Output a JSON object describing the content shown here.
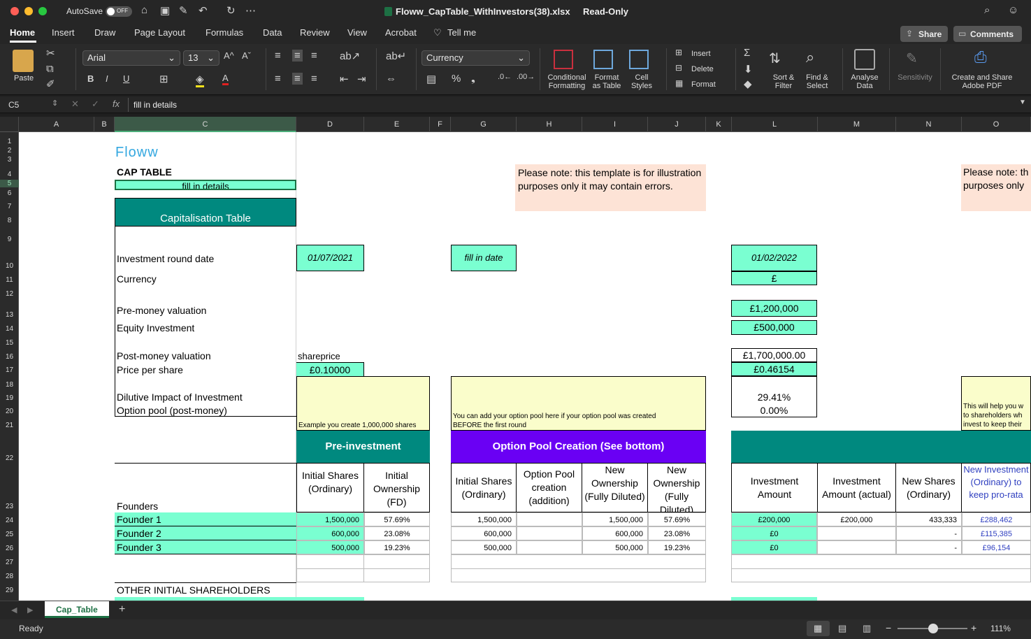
{
  "window": {
    "title": "Floww_CapTable_WithInvestors(38).xlsx",
    "mode": "Read-Only",
    "autosave": "AutoSave",
    "autosave_state": "OFF"
  },
  "ribbon_tabs": [
    "Home",
    "Insert",
    "Draw",
    "Page Layout",
    "Formulas",
    "Data",
    "Review",
    "View",
    "Acrobat",
    "Tell me"
  ],
  "share": "Share",
  "comments": "Comments",
  "ribbon": {
    "paste": "Paste",
    "font": "Arial",
    "size": "13",
    "number_format": "Currency",
    "cond_fmt_1": "Conditional",
    "cond_fmt_2": "Formatting",
    "fmt_table_1": "Format",
    "fmt_table_2": "as Table",
    "cell_styles_1": "Cell",
    "cell_styles_2": "Styles",
    "insert": "Insert",
    "delete": "Delete",
    "format": "Format",
    "sort_1": "Sort &",
    "sort_2": "Filter",
    "find_1": "Find &",
    "find_2": "Select",
    "analyse_1": "Analyse",
    "analyse_2": "Data",
    "sensitivity": "Sensitivity",
    "adobe_1": "Create and Share",
    "adobe_2": "Adobe PDF"
  },
  "formula_bar": {
    "cell_ref": "C5",
    "fx": "fx",
    "content": "fill in details"
  },
  "columns": [
    "A",
    "B",
    "C",
    "D",
    "E",
    "F",
    "G",
    "H",
    "I",
    "J",
    "K",
    "L",
    "M",
    "N",
    "O"
  ],
  "rows": [
    "1",
    "2",
    "3",
    "4",
    "5",
    "6",
    "7",
    "8",
    "9",
    "10",
    "11",
    "12",
    "13",
    "14",
    "15",
    "16",
    "17",
    "18",
    "19",
    "20",
    "21",
    "22",
    "23",
    "24",
    "25",
    "26",
    "27",
    "28",
    "29"
  ],
  "sheet": {
    "logo": "Floww",
    "cap_table": "CAP TABLE",
    "fill_details": "fill in details",
    "note": "Please note: this template is for illustration purposes only it may contain errors.",
    "note_right_1": "Please note: th",
    "note_right_2": "purposes only",
    "cap_title": "Capitalisation Table",
    "labels": {
      "round_date": "Investment round date",
      "currency": "Currency",
      "pre_money": "Pre-money valuation",
      "equity": "Equity Investment",
      "post_money": "Post-money valuation",
      "pps": "Price per share",
      "dilutive": "Dilutive Impact of Investment",
      "option_pool": "Option pool (post-money)",
      "founders": "Founders",
      "other": "OTHER INITIAL SHAREHOLDERS"
    },
    "d_date": "01/07/2021",
    "g_date": "fill in date",
    "l_date": "01/02/2022",
    "l_currency": "£",
    "l_pre": "£1,200,000",
    "l_equity": "£500,000",
    "l_post": "£1,700,000.00",
    "d_shareprice_label": "shareprice",
    "d_pps": "£0.10000",
    "l_pps": "£0.46154",
    "l_dilutive": "29.41%",
    "l_pool": "0.00%",
    "d_example": "Example you create 1,000,000 shares",
    "g_note_1": "You can add your option pool here if your option pool was created",
    "g_note_2": "BEFORE the first round",
    "o_note_1": "This will help you w",
    "o_note_2": "to shareholders wh",
    "o_note_3": "invest to keep their",
    "pre_investment": "Pre-investment",
    "option_pool_creation": "Option Pool Creation (See bottom)",
    "headers": {
      "d": "Initial Shares (Ordinary)",
      "e": "Initial Ownership (FD)",
      "g": "Initial Shares (Ordinary)",
      "h": "Option Pool creation (addition)",
      "i": "New Ownership (Fully Diluted)",
      "j": "New Ownership (Fully Diluted)",
      "l": "Investment Amount",
      "m": "Investment Amount (actual)",
      "n": "New Shares (Ordinary)",
      "o": "New Investment (Ordinary) to keep pro-rata"
    },
    "founders": [
      {
        "name": "Founder 1",
        "d": "1,500,000",
        "e": "57.69%",
        "g": "1,500,000",
        "i": "1,500,000",
        "j": "57.69%",
        "l": "£200,000",
        "m": "£200,000",
        "n": "433,333",
        "o": "£288,462"
      },
      {
        "name": "Founder 2",
        "d": "600,000",
        "e": "23.08%",
        "g": "600,000",
        "i": "600,000",
        "j": "23.08%",
        "l": "£0",
        "m": "",
        "n": "-",
        "o": "£115,385"
      },
      {
        "name": "Founder 3",
        "d": "500,000",
        "e": "19.23%",
        "g": "500,000",
        "i": "500,000",
        "j": "19.23%",
        "l": "£0",
        "m": "",
        "n": "-",
        "o": "£96,154"
      }
    ]
  },
  "sheet_tab": "Cap_Table",
  "add_sheet": "+",
  "status": {
    "ready": "Ready",
    "zoom": "111%",
    "minus": "−",
    "plus": "+"
  },
  "colors": {
    "teal": "#00897f",
    "mint": "#7affd1",
    "purple": "#6a00f4",
    "yellow": "#fafdcb",
    "peach": "#fde3d6",
    "excel_green": "#1d7044"
  }
}
